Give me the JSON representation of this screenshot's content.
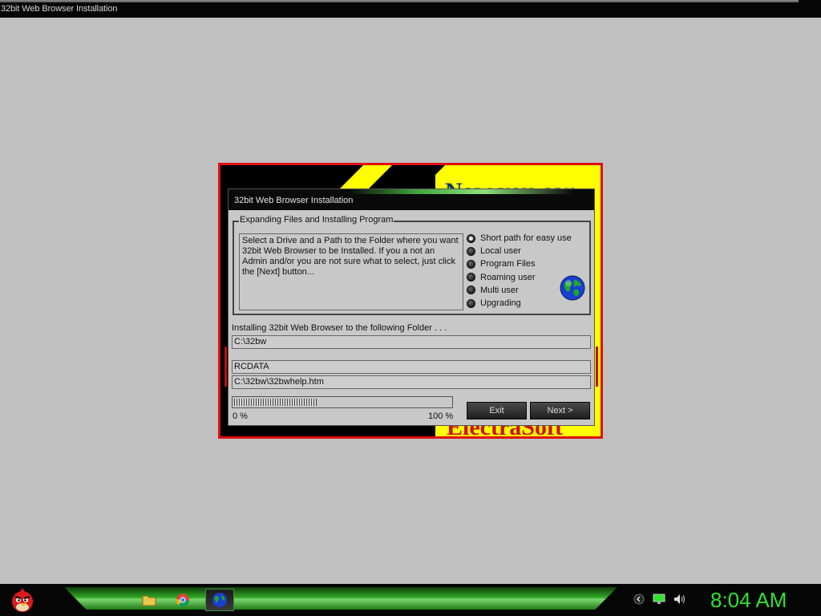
{
  "window": {
    "title": "32bit Web Browser Installation"
  },
  "splash": {
    "top_text": "Now you can",
    "bottom_text": "ElectraSoft"
  },
  "dialog": {
    "title": "32bit Web Browser Installation",
    "group_legend": "Expanding Files and Installing Program",
    "description": "Select a Drive and a Path to the Folder where you want 32bit Web Browser to be Installed. If you a not an Admin and/or you are not sure what to select, just click the [Next] button...",
    "options": [
      {
        "label": "Short path for easy use",
        "selected": true
      },
      {
        "label": "Local user",
        "selected": false
      },
      {
        "label": "Program Files",
        "selected": false
      },
      {
        "label": "Roaming user",
        "selected": false
      },
      {
        "label": "Multi user",
        "selected": false
      },
      {
        "label": "Upgrading",
        "selected": false
      }
    ],
    "install_label": "Installing 32bit Web Browser to the following Folder . . .",
    "install_path": "C:\\32bw",
    "resource_type": "RCDATA",
    "current_file": "C:\\32bw\\32bwhelp.htm",
    "progress_fraction": 0.38,
    "progress_min_label": "0 %",
    "progress_max_label": "100 %",
    "exit_label": "Exit",
    "next_label": "Next >"
  },
  "taskbar": {
    "clock": "8:04 AM",
    "colors": {
      "clock": "#2ee22e",
      "accent": "#2fa824"
    },
    "icons": [
      "angry-bird-start-icon",
      "folder-icon",
      "chrome-icon",
      "globe-browser-icon"
    ]
  }
}
